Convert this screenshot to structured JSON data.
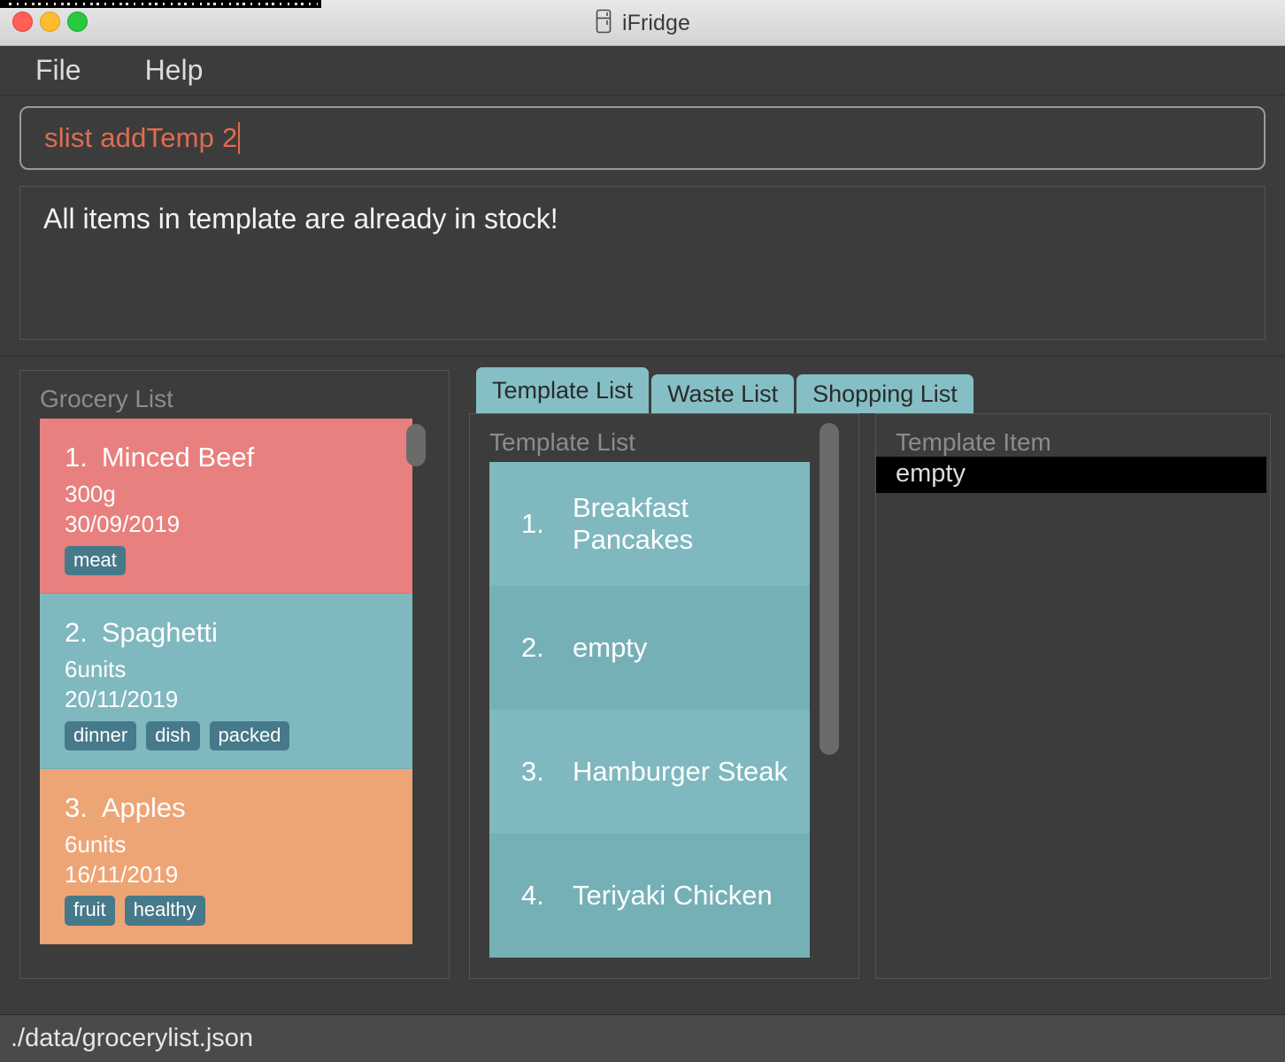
{
  "window": {
    "title": "iFridge",
    "icon": "fridge-icon"
  },
  "menubar": {
    "items": [
      {
        "label": "File"
      },
      {
        "label": "Help"
      }
    ]
  },
  "command": {
    "value": "slist addTemp 2",
    "text_color": "#e06c50"
  },
  "result": {
    "message": "All items in template are already in stock!"
  },
  "grocery_panel": {
    "title": "Grocery List",
    "items": [
      {
        "index": "1.",
        "name": "Minced Beef",
        "quantity": "300g",
        "date": "30/09/2019",
        "tags": [
          "meat"
        ],
        "color": "#e8807f"
      },
      {
        "index": "2.",
        "name": "Spaghetti",
        "quantity": "6units",
        "date": "20/11/2019",
        "tags": [
          "dinner",
          "dish",
          "packed"
        ],
        "color": "#7fb8bf"
      },
      {
        "index": "3.",
        "name": "Apples",
        "quantity": "6units",
        "date": "16/11/2019",
        "tags": [
          "fruit",
          "healthy"
        ],
        "color": "#eda576"
      }
    ]
  },
  "tabs": [
    {
      "label": "Template List",
      "active": true
    },
    {
      "label": "Waste List",
      "active": false
    },
    {
      "label": "Shopping List",
      "active": false
    }
  ],
  "template_list_panel": {
    "title": "Template List",
    "items": [
      {
        "index": "1.",
        "name": "Breakfast Pancakes"
      },
      {
        "index": "2.",
        "name": "empty"
      },
      {
        "index": "3.",
        "name": "Hamburger Steak"
      },
      {
        "index": "4.",
        "name": "Teriyaki Chicken"
      }
    ]
  },
  "template_item_panel": {
    "title": "Template Item",
    "rows": [
      "empty"
    ]
  },
  "statusbar": {
    "path": "./data/grocerylist.json"
  },
  "colors": {
    "accent_teal": "#7fb8bf",
    "tag": "#46798a",
    "command_text": "#e06c50",
    "background": "#3c3c3c"
  }
}
